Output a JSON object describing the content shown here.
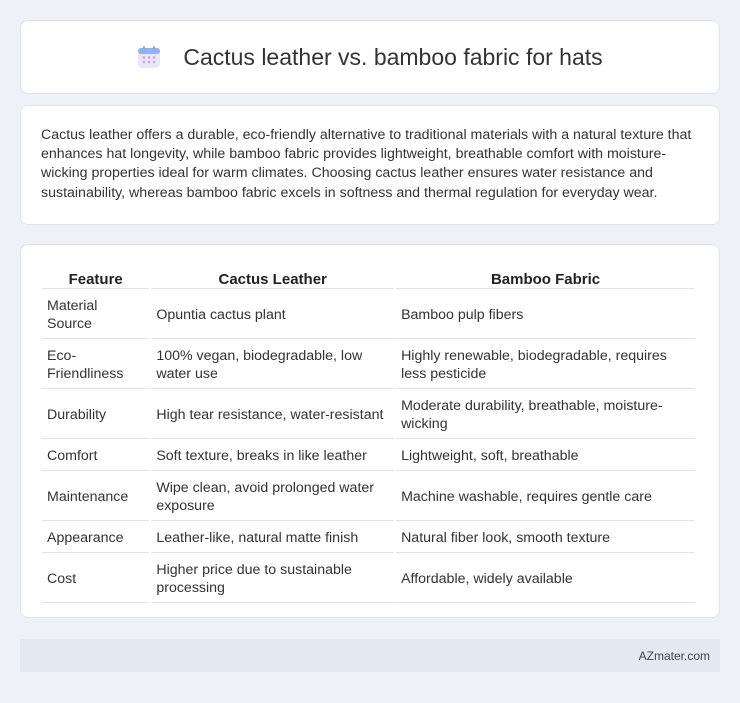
{
  "header": {
    "title": "Cactus leather vs. bamboo fabric for hats",
    "icon": "calendar-icon"
  },
  "summary": {
    "text": "Cactus leather offers a durable, eco-friendly alternative to traditional materials with a natural texture that enhances hat longevity, while bamboo fabric provides lightweight, breathable comfort with moisture-wicking properties ideal for warm climates. Choosing cactus leather ensures water resistance and sustainability, whereas bamboo fabric excels in softness and thermal regulation for everyday wear."
  },
  "table": {
    "headers": [
      "Feature",
      "Cactus Leather",
      "Bamboo Fabric"
    ],
    "rows": [
      [
        "Material Source",
        "Opuntia cactus plant",
        "Bamboo pulp fibers"
      ],
      [
        "Eco-Friendliness",
        "100% vegan, biodegradable, low water use",
        "Highly renewable, biodegradable, requires less pesticide"
      ],
      [
        "Durability",
        "High tear resistance, water-resistant",
        "Moderate durability, breathable, moisture-wicking"
      ],
      [
        "Comfort",
        "Soft texture, breaks in like leather",
        "Lightweight, soft, breathable"
      ],
      [
        "Maintenance",
        "Wipe clean, avoid prolonged water exposure",
        "Machine washable, requires gentle care"
      ],
      [
        "Appearance",
        "Leather-like, natural matte finish",
        "Natural fiber look, smooth texture"
      ],
      [
        "Cost",
        "Higher price due to sustainable processing",
        "Affordable, widely available"
      ]
    ]
  },
  "footer": {
    "brand": "AZmater.com"
  }
}
